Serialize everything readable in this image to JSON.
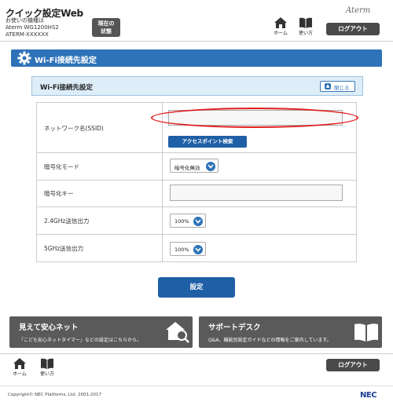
{
  "header": {
    "title": "クイック設定Web",
    "model_line1": "お使いの機種は",
    "model_line2": "Aterm WG1200HS2",
    "model_line3": "ATERM-XXXXXX",
    "status_button_line1": "現在の",
    "status_button_line2": "状態",
    "brand": "Aterm",
    "home_label": "ホーム",
    "help_label": "使い方",
    "logout_label": "ログアウト"
  },
  "section": {
    "title": "Wi-Fi接続先設定",
    "panel_title": "Wi-Fi接続先設定",
    "close_label": "閉じる"
  },
  "form": {
    "ssid_label": "ネットワーク名(SSID)",
    "ssid_value": "",
    "scan_button": "アクセスポイント検索",
    "encryption_mode_label": "暗号化モード",
    "encryption_mode_value": "暗号化無効",
    "encryption_key_label": "暗号化キー",
    "encryption_key_value": "",
    "tx_24_label": "2.4GHz送信出力",
    "tx_24_value": "100%",
    "tx_5_label": "5GHz送信出力",
    "tx_5_value": "100%",
    "submit_label": "設定"
  },
  "banners": {
    "left_title": "見えて安心ネット",
    "left_desc": "「こども安心ネットタイマー」などの設定はこちらから。",
    "right_title": "サポートデスク",
    "right_desc": "Q&A、機能別設定ガイドなどの情報をご案内しています。"
  },
  "footer": {
    "home_label": "ホーム",
    "help_label": "使い方",
    "logout_label": "ログアウト",
    "copyright": "Copyright© NEC Platforms, Ltd. 2001-2017",
    "company": "NEC"
  },
  "colors": {
    "accent": "#2e73b8",
    "dark_button": "#4a4a4a",
    "highlight_ellipse": "#e11d1d"
  }
}
